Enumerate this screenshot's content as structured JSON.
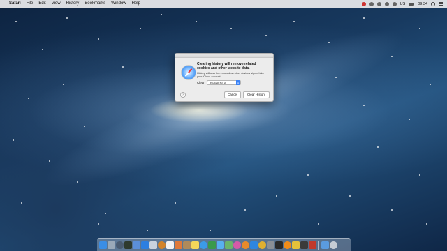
{
  "menubar": {
    "apple_glyph": "",
    "app_name": "Safari",
    "menus": [
      "File",
      "Edit",
      "View",
      "History",
      "Bookmarks",
      "Window",
      "Help"
    ],
    "status": {
      "locale": "US",
      "clock": "09:34"
    }
  },
  "dialog": {
    "title": "Clearing history will remove related cookies and other website data.",
    "info": "History will also be removed on other devices signed into your iCloud account.",
    "clear_label": "Clear:",
    "clear_value": "the last hour",
    "help_glyph": "?",
    "cancel_label": "Cancel",
    "confirm_label": "Clear History"
  },
  "dock": {
    "items": [
      {
        "name": "finder-icon",
        "color": "#3a8ee6"
      },
      {
        "name": "launchpad-icon",
        "color": "#9aa9b8"
      },
      {
        "name": "mission-control-icon",
        "color": "#4a5b70"
      },
      {
        "name": "activity-monitor-icon",
        "color": "#2e3a2e"
      },
      {
        "name": "system-icon",
        "color": "#5b8fd8"
      },
      {
        "name": "safari-icon",
        "color": "#2d7fe0"
      },
      {
        "name": "preview-icon",
        "color": "#c8d2de"
      },
      {
        "name": "app-orange-icon",
        "color": "#d2842a"
      },
      {
        "name": "calendar-icon",
        "color": "#f2f2f2"
      },
      {
        "name": "photos-icon",
        "color": "#e07a3a"
      },
      {
        "name": "contacts-icon",
        "color": "#b08a5a"
      },
      {
        "name": "notes-icon",
        "color": "#f4d65a"
      },
      {
        "name": "app-store-icon",
        "color": "#3b9be8"
      },
      {
        "name": "facetime-icon",
        "color": "#3a9a4a"
      },
      {
        "name": "messages-icon",
        "color": "#58b0f0"
      },
      {
        "name": "maps-icon",
        "color": "#6bb56b"
      },
      {
        "name": "itunes-icon",
        "color": "#d55aa8"
      },
      {
        "name": "ibooks-icon",
        "color": "#e88a2a"
      },
      {
        "name": "app-store-2-icon",
        "color": "#2f86e0"
      },
      {
        "name": "chrome-icon",
        "color": "#e0b030"
      },
      {
        "name": "system-preferences-icon",
        "color": "#8a8f96"
      },
      {
        "name": "terminal-icon",
        "color": "#2a2a2a"
      },
      {
        "name": "vlc-icon",
        "color": "#f08c1a"
      },
      {
        "name": "app-yellow-icon",
        "color": "#e6c23a"
      },
      {
        "name": "app-dark-icon",
        "color": "#3a3a3a"
      },
      {
        "name": "app-red-icon",
        "color": "#c0392b"
      },
      {
        "name": "downloads-icon",
        "color": "#5a9be0"
      },
      {
        "name": "trash-icon",
        "color": "#c6ccd4"
      }
    ]
  }
}
